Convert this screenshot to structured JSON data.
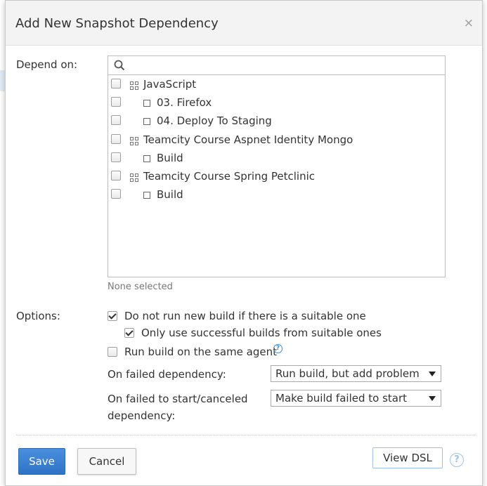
{
  "dialog": {
    "title": "Add New Snapshot Dependency",
    "close_glyph": "×"
  },
  "depend_on": {
    "label": "Depend on:",
    "search": {
      "value": "",
      "placeholder": ""
    },
    "tree": [
      {
        "kind": "project",
        "label": "JavaScript",
        "checked": false
      },
      {
        "kind": "config",
        "label": "03. Firefox",
        "checked": false
      },
      {
        "kind": "config",
        "label": "04. Deploy To Staging",
        "checked": false
      },
      {
        "kind": "project",
        "label": "Teamcity Course Aspnet Identity Mongo",
        "checked": false
      },
      {
        "kind": "config",
        "label": "Build",
        "checked": false
      },
      {
        "kind": "project",
        "label": "Teamcity Course Spring Petclinic",
        "checked": false
      },
      {
        "kind": "config",
        "label": "Build",
        "checked": false
      }
    ],
    "selection_status": "None selected"
  },
  "options": {
    "label": "Options:",
    "do_not_run_new_build": {
      "label": "Do not run new build if there is a suitable one",
      "checked": true
    },
    "only_successful": {
      "label": "Only use successful builds from suitable ones",
      "checked": true
    },
    "same_agent": {
      "label": "Run build on the same agent",
      "checked": false,
      "help_glyph": "?"
    },
    "on_failed_dependency": {
      "label": "On failed dependency:",
      "value": "Run build, but add problem"
    },
    "on_failed_to_start": {
      "label_line1": "On failed to start/canceled",
      "label_line2": "dependency:",
      "value": "Make build failed to start"
    }
  },
  "footer": {
    "save_label": "Save",
    "cancel_label": "Cancel",
    "view_dsl_label": "View DSL",
    "help_glyph": "?"
  },
  "colors": {
    "primary": "#3b7fd2",
    "help_blue": "#3b8cd5"
  }
}
